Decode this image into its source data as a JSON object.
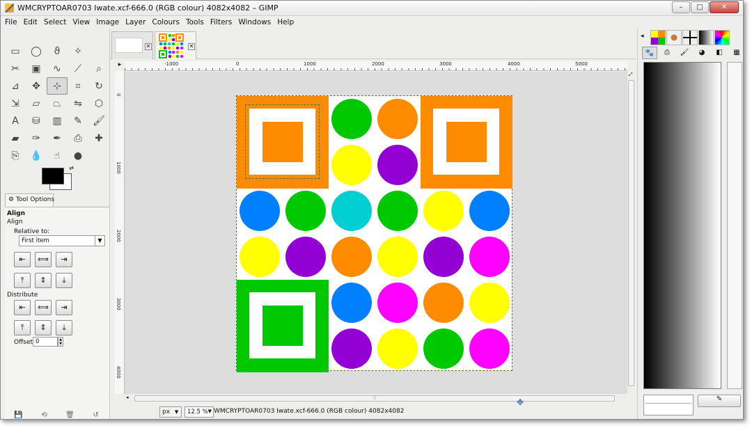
{
  "window": {
    "title": "WMCRYPTOAR0703 Iwate.xcf-666.0 (RGB colour) 4082x4082 – GIMP"
  },
  "window_controls": {
    "minimize": "–",
    "maximize": "□",
    "close": "✕"
  },
  "menubar": [
    "File",
    "Edit",
    "Select",
    "View",
    "Image",
    "Layer",
    "Colours",
    "Tools",
    "Filters",
    "Windows",
    "Help"
  ],
  "toolbox": {
    "tools": [
      {
        "name": "rect-select-tool-icon",
        "glyph": "▭"
      },
      {
        "name": "ellipse-select-tool-icon",
        "glyph": "◯"
      },
      {
        "name": "free-select-tool-icon",
        "glyph": "ϑ"
      },
      {
        "name": "fuzzy-select-tool-icon",
        "glyph": "✧"
      },
      {
        "name": "empty",
        "glyph": ""
      },
      {
        "name": "scissors-select-tool-icon",
        "glyph": "✂"
      },
      {
        "name": "foreground-select-tool-icon",
        "glyph": "▣"
      },
      {
        "name": "paths-tool-icon",
        "glyph": "∿"
      },
      {
        "name": "color-picker-tool-icon",
        "glyph": "⟋"
      },
      {
        "name": "zoom-tool-icon",
        "glyph": "⌕"
      },
      {
        "name": "measure-tool-icon",
        "glyph": "⊿"
      },
      {
        "name": "move-tool-icon",
        "glyph": "✥"
      },
      {
        "name": "align-tool-icon",
        "glyph": "⊹"
      },
      {
        "name": "crop-tool-icon",
        "glyph": "⌗"
      },
      {
        "name": "rotate-tool-icon",
        "glyph": "↻"
      },
      {
        "name": "scale-tool-icon",
        "glyph": "⇲"
      },
      {
        "name": "shear-tool-icon",
        "glyph": "▱"
      },
      {
        "name": "perspective-tool-icon",
        "glyph": "⏢"
      },
      {
        "name": "flip-tool-icon",
        "glyph": "⇋"
      },
      {
        "name": "cage-transform-tool-icon",
        "glyph": "⬡"
      },
      {
        "name": "text-tool-icon",
        "glyph": "A"
      },
      {
        "name": "bucket-fill-tool-icon",
        "glyph": "⛁"
      },
      {
        "name": "blend-tool-icon",
        "glyph": "▥"
      },
      {
        "name": "pencil-tool-icon",
        "glyph": "✎"
      },
      {
        "name": "paintbrush-tool-icon",
        "glyph": "🖌"
      },
      {
        "name": "eraser-tool-icon",
        "glyph": "▰"
      },
      {
        "name": "airbrush-tool-icon",
        "glyph": "✑"
      },
      {
        "name": "ink-tool-icon",
        "glyph": "✒"
      },
      {
        "name": "clone-tool-icon",
        "glyph": "⎙"
      },
      {
        "name": "heal-tool-icon",
        "glyph": "✚"
      },
      {
        "name": "perspective-clone-tool-icon",
        "glyph": "⎘"
      },
      {
        "name": "blur-tool-icon",
        "glyph": "💧"
      },
      {
        "name": "smudge-tool-icon",
        "glyph": "☝"
      },
      {
        "name": "dodge-burn-tool-icon",
        "glyph": "●"
      }
    ],
    "active_tool_index": 12,
    "colors": {
      "foreground": "#000000",
      "background": "#ffffff"
    },
    "tool_options_tab": "Tool Options",
    "align_heading": "Align",
    "align_subheading": "Align",
    "relative_to_label": "Relative to:",
    "relative_to_value": "First item",
    "distribute_label": "Distribute",
    "offset_label": "Offset:",
    "offset_value": "0",
    "align_buttons_row1": [
      "⇤",
      "⟺",
      "⇥"
    ],
    "align_buttons_row2": [
      "⤒",
      "⇕",
      "⤓"
    ],
    "distribute_buttons_row1": [
      "⇤",
      "⟺",
      "⇥"
    ],
    "distribute_buttons_row2": [
      "⤒",
      "⇕",
      "⤓"
    ],
    "bottom_icons": [
      "save-icon",
      "restore-icon",
      "delete-icon",
      "reset-icon"
    ]
  },
  "image_tabs": [
    {
      "label": ""
    },
    {
      "label": ""
    }
  ],
  "rulers": {
    "horizontal_labels": [
      "-1000",
      "0",
      "1000",
      "2000",
      "3000",
      "4000",
      "5000"
    ],
    "vertical_labels": [
      "0",
      "1000",
      "2000",
      "3000",
      "4000"
    ]
  },
  "canvas": {
    "selection_border": "#6b6b2a",
    "squares": [
      {
        "name": "square-orange-topleft",
        "color": "#ff8c00",
        "selected": true
      },
      {
        "name": "square-orange-topright",
        "color": "#ff8c00",
        "selected": false
      },
      {
        "name": "square-green-bottomleft",
        "color": "#00c800",
        "selected": false
      }
    ],
    "circles": [
      {
        "color": "#00c800"
      },
      {
        "color": "#ff8c00"
      },
      {
        "color": "#ffff00"
      },
      {
        "color": "#9400d3"
      },
      {
        "color": "#0080ff"
      },
      {
        "color": "#00c800"
      },
      {
        "color": "#00ced1"
      },
      {
        "color": "#00c800"
      },
      {
        "color": "#ffff00"
      },
      {
        "color": "#0080ff"
      },
      {
        "color": "#ffff00"
      },
      {
        "color": "#9400d3"
      },
      {
        "color": "#ff8c00"
      },
      {
        "color": "#ffff00"
      },
      {
        "color": "#9400d3"
      },
      {
        "color": "#ff00ff"
      },
      {
        "color": "#0080ff"
      },
      {
        "color": "#ff00ff"
      },
      {
        "color": "#ff8c00"
      },
      {
        "color": "#ffff00"
      },
      {
        "color": "#9400d3"
      },
      {
        "color": "#ffff00"
      },
      {
        "color": "#00c800"
      },
      {
        "color": "#ff00ff"
      }
    ]
  },
  "statusbar": {
    "unit": "px",
    "zoom": "12.5 %",
    "text": "WMCRYPTOAR0703 Iwate.xcf-666.0 (RGB colour) 4082x4082"
  },
  "dock": {
    "tabs": [
      "patterns",
      "brushes",
      "fonts",
      "gradients",
      "palettes"
    ],
    "icons": [
      "gimp-icon",
      "printer-icon",
      "brush-icon",
      "palette-icon",
      "swatch-icon",
      "pattern-icon"
    ],
    "gradient_start": "#000000",
    "gradient_end": "#ffffff"
  }
}
